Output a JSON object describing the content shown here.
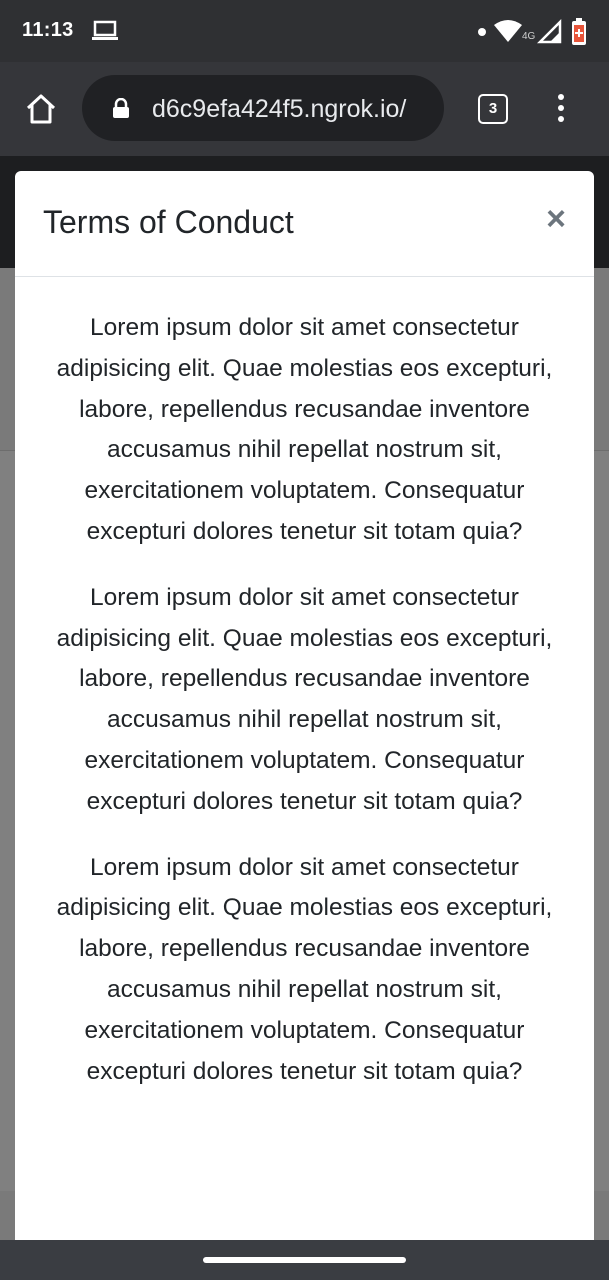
{
  "status_bar": {
    "time": "11:13",
    "network": "4G",
    "icons": [
      "laptop-icon",
      "dot-icon",
      "wifi-icon",
      "signal-icon",
      "battery-icon"
    ]
  },
  "browser": {
    "url": "d6c9efa424f5.ngrok.io/",
    "tab_count": "3",
    "icons": [
      "home-icon",
      "lock-icon",
      "tabs-icon",
      "more-vert-icon"
    ]
  },
  "modal": {
    "title": "Terms of Conduct",
    "close_label": "×",
    "paragraphs": [
      "Lorem ipsum dolor sit amet consectetur adipisicing elit. Quae molestias eos excepturi, labore, repellendus recusandae inventore accusamus nihil repellat nostrum sit, exercitationem voluptatem. Consequatur excepturi dolores tenetur sit totam quia?",
      "Lorem ipsum dolor sit amet consectetur adipisicing elit. Quae molestias eos excepturi, labore, repellendus recusandae inventore accusamus nihil repellat nostrum sit, exercitationem voluptatem. Consequatur excepturi dolores tenetur sit totam quia?",
      "Lorem ipsum dolor sit amet consectetur adipisicing elit. Quae molestias eos excepturi, labore, repellendus recusandae inventore accusamus nihil repellat nostrum sit, exercitationem voluptatem. Consequatur excepturi dolores tenetur sit totam quia?"
    ]
  },
  "colors": {
    "status_bar": "#2f3033",
    "toolbar": "#35363a",
    "url_pill": "#202124",
    "overlay": "#7a7a7a",
    "modal_bg": "#ffffff",
    "text": "#212529",
    "close": "#6c757d"
  }
}
